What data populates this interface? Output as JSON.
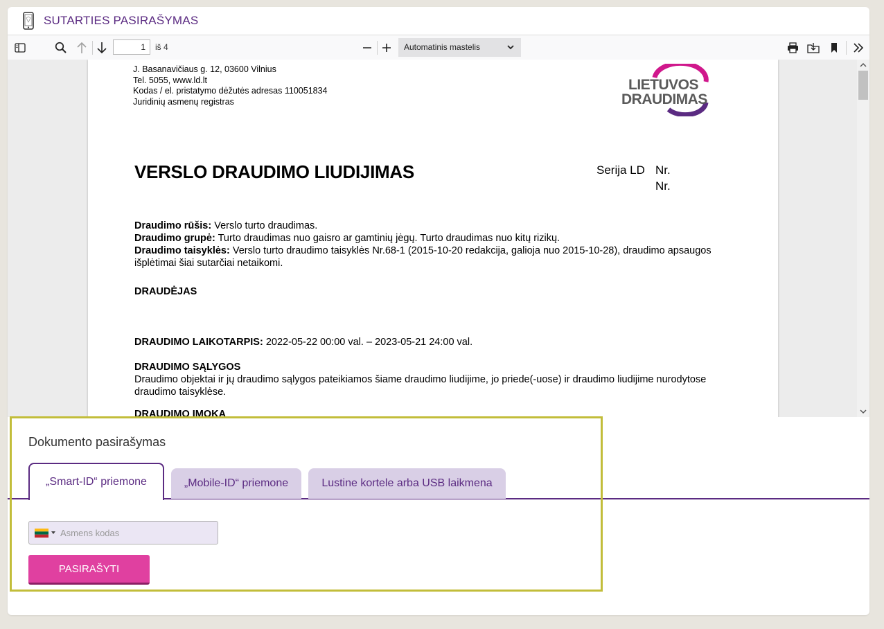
{
  "header": {
    "title": "SUTARTIES PASIRAŠYMAS",
    "icon": "mobile-phone-icon"
  },
  "toolbar": {
    "page_number": "1",
    "page_of": "iš 4",
    "zoom_value": "Automatinis mastelis",
    "icons": [
      "sidebar-toggle-icon",
      "search-icon",
      "arrow-up-icon",
      "arrow-down-icon",
      "zoom-out-icon",
      "zoom-in-icon",
      "chevron-down-icon",
      "print-icon",
      "download-icon",
      "bookmark-icon",
      "double-chevron-right-icon"
    ]
  },
  "document": {
    "address_lines": [
      "J. Basanavičiaus g. 12, 03600 Vilnius",
      "Tel. 5055, www.ld.lt",
      "Kodas / el. pristatymo dėžutės adresas 110051834",
      "Juridinių asmenų registras"
    ],
    "logo_lines": [
      "LIETUVOS",
      "DRAUDIMAS"
    ],
    "logo_colors": {
      "magenta": "#d0188c",
      "purple": "#5b2b82",
      "text": "#5a5a5a"
    },
    "title": "VERSLO DRAUDIMO LIUDIJIMAS",
    "serija": "Serija LD",
    "nr1": "Nr.",
    "nr2": "Nr.",
    "rusis_label": "Draudimo rūšis:",
    "rusis_value": " Verslo turto draudimas.",
    "grupe_label": "Draudimo grupė:",
    "grupe_value": " Turto draudimas nuo gaisro ar gamtinių jėgų. Turto draudimas nuo kitų rizikų.",
    "taisykles_label": "Draudimo taisyklės:",
    "taisykles_value": " Verslo turto draudimo taisyklės Nr.68-1 (2015-10-20 redakcija, galioja nuo 2015-10-28), draudimo apsaugos išplėtimai šiai sutarčiai netaikomi.",
    "draudejas": "DRAUDĖJAS",
    "laikotarpis_label": "DRAUDIMO LAIKOTARPIS:",
    "laikotarpis_value": " 2022-05-22 00:00 val. – 2023-05-21 24:00 val.",
    "salygos_label": "DRAUDIMO SĄLYGOS",
    "salygos_text": "Draudimo objektai ir jų draudimo sąlygos pateikiamos šiame draudimo liudijime, jo priede(-uose) ir draudimo liudijime nurodytose draudimo taisyklėse.",
    "imoka_label": "DRAUDIMO ĮMOKA"
  },
  "signing": {
    "title": "Dokumento pasirašymas",
    "tabs": [
      {
        "label": "„Smart-ID“ priemone",
        "active": true
      },
      {
        "label": "„Mobile-ID“ priemone",
        "active": false
      },
      {
        "label": "Lustine kortele arba USB laikmena",
        "active": false
      }
    ],
    "id_placeholder": "Asmens kodas",
    "country_flag": "lithuania-flag-icon",
    "sign_button": "PASIRAŠYTI",
    "colors": {
      "brand_purple": "#5b2b82",
      "button_pink": "#e040a0",
      "highlight_border": "#c2bd3a"
    }
  }
}
